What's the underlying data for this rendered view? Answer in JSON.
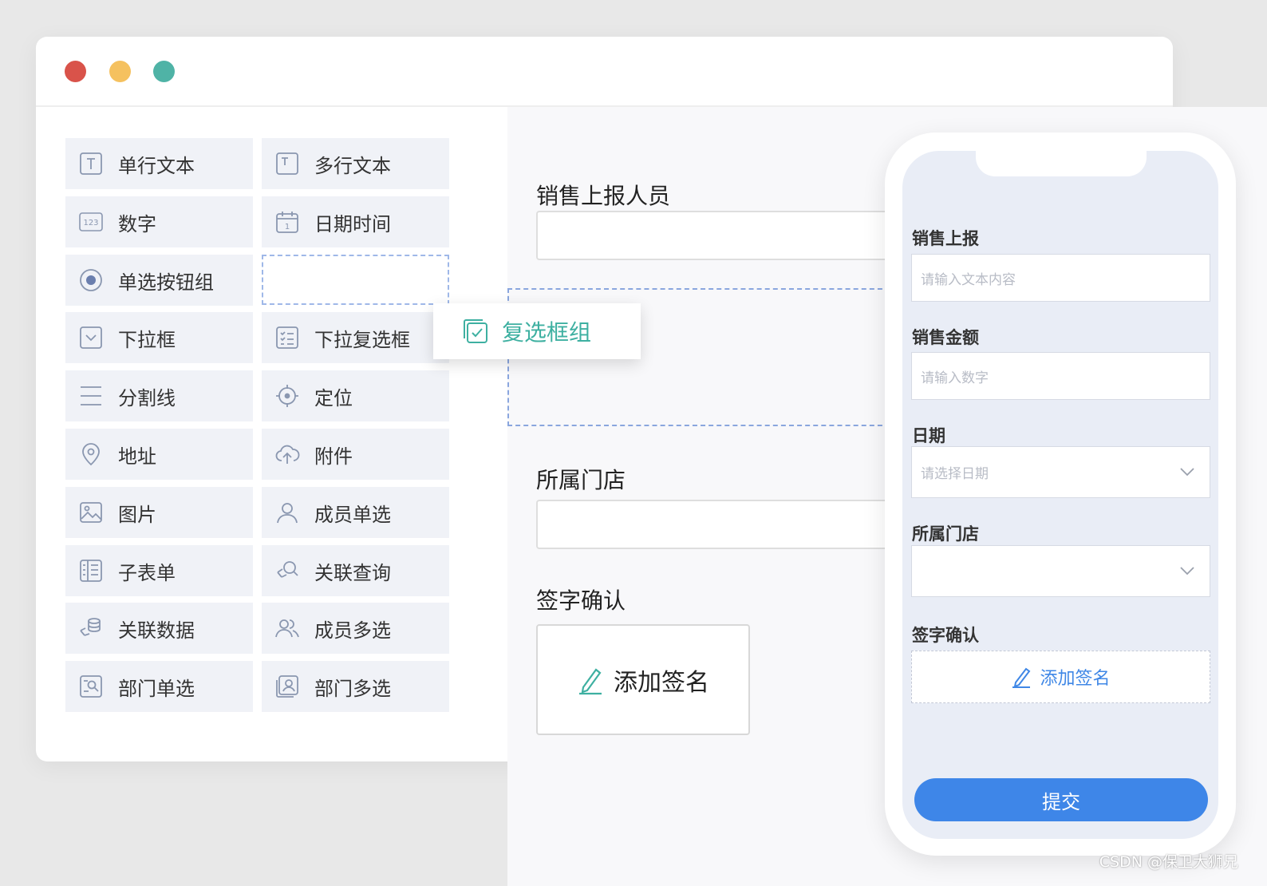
{
  "palette": {
    "items": [
      {
        "label": "单行文本",
        "icon": "single-line-text-icon"
      },
      {
        "label": "多行文本",
        "icon": "multi-line-text-icon"
      },
      {
        "label": "数字",
        "icon": "number-icon"
      },
      {
        "label": "日期时间",
        "icon": "calendar-icon"
      },
      {
        "label": "单选按钮组",
        "icon": "radio-icon"
      },
      {
        "label": "下拉框",
        "icon": "dropdown-icon"
      },
      {
        "label": "下拉复选框",
        "icon": "checklist-icon"
      },
      {
        "label": "分割线",
        "icon": "divider-icon"
      },
      {
        "label": "定位",
        "icon": "locate-icon"
      },
      {
        "label": "地址",
        "icon": "map-pin-icon"
      },
      {
        "label": "附件",
        "icon": "upload-cloud-icon"
      },
      {
        "label": "图片",
        "icon": "image-icon"
      },
      {
        "label": "成员单选",
        "icon": "user-icon"
      },
      {
        "label": "子表单",
        "icon": "subform-icon"
      },
      {
        "label": "关联查询",
        "icon": "link-search-icon"
      },
      {
        "label": "关联数据",
        "icon": "link-data-icon"
      },
      {
        "label": "成员多选",
        "icon": "users-icon"
      },
      {
        "label": "部门单选",
        "icon": "dept-icon"
      },
      {
        "label": "部门多选",
        "icon": "dept-multi-icon"
      }
    ]
  },
  "dragging": {
    "label": "复选框组",
    "icon": "checkbox-group-icon"
  },
  "canvas": {
    "fields": [
      {
        "label": "销售上报人员"
      },
      {
        "label": "所属门店"
      }
    ],
    "signature": {
      "label": "签字确认",
      "button": "添加签名"
    }
  },
  "mobile": {
    "fields": [
      {
        "label": "销售上报",
        "placeholder": "请输入文本内容"
      },
      {
        "label": "销售金额",
        "placeholder": "请输入数字"
      },
      {
        "label": "日期",
        "placeholder": "请选择日期"
      },
      {
        "label": "所属门店",
        "placeholder": ""
      }
    ],
    "signature": {
      "label": "签字确认",
      "button": "添加签名"
    },
    "submit": "提交"
  },
  "colors": {
    "accent_green": "#3eb0a1",
    "accent_blue": "#3e86e8"
  },
  "watermark": "CSDN @保卫大狮兄"
}
